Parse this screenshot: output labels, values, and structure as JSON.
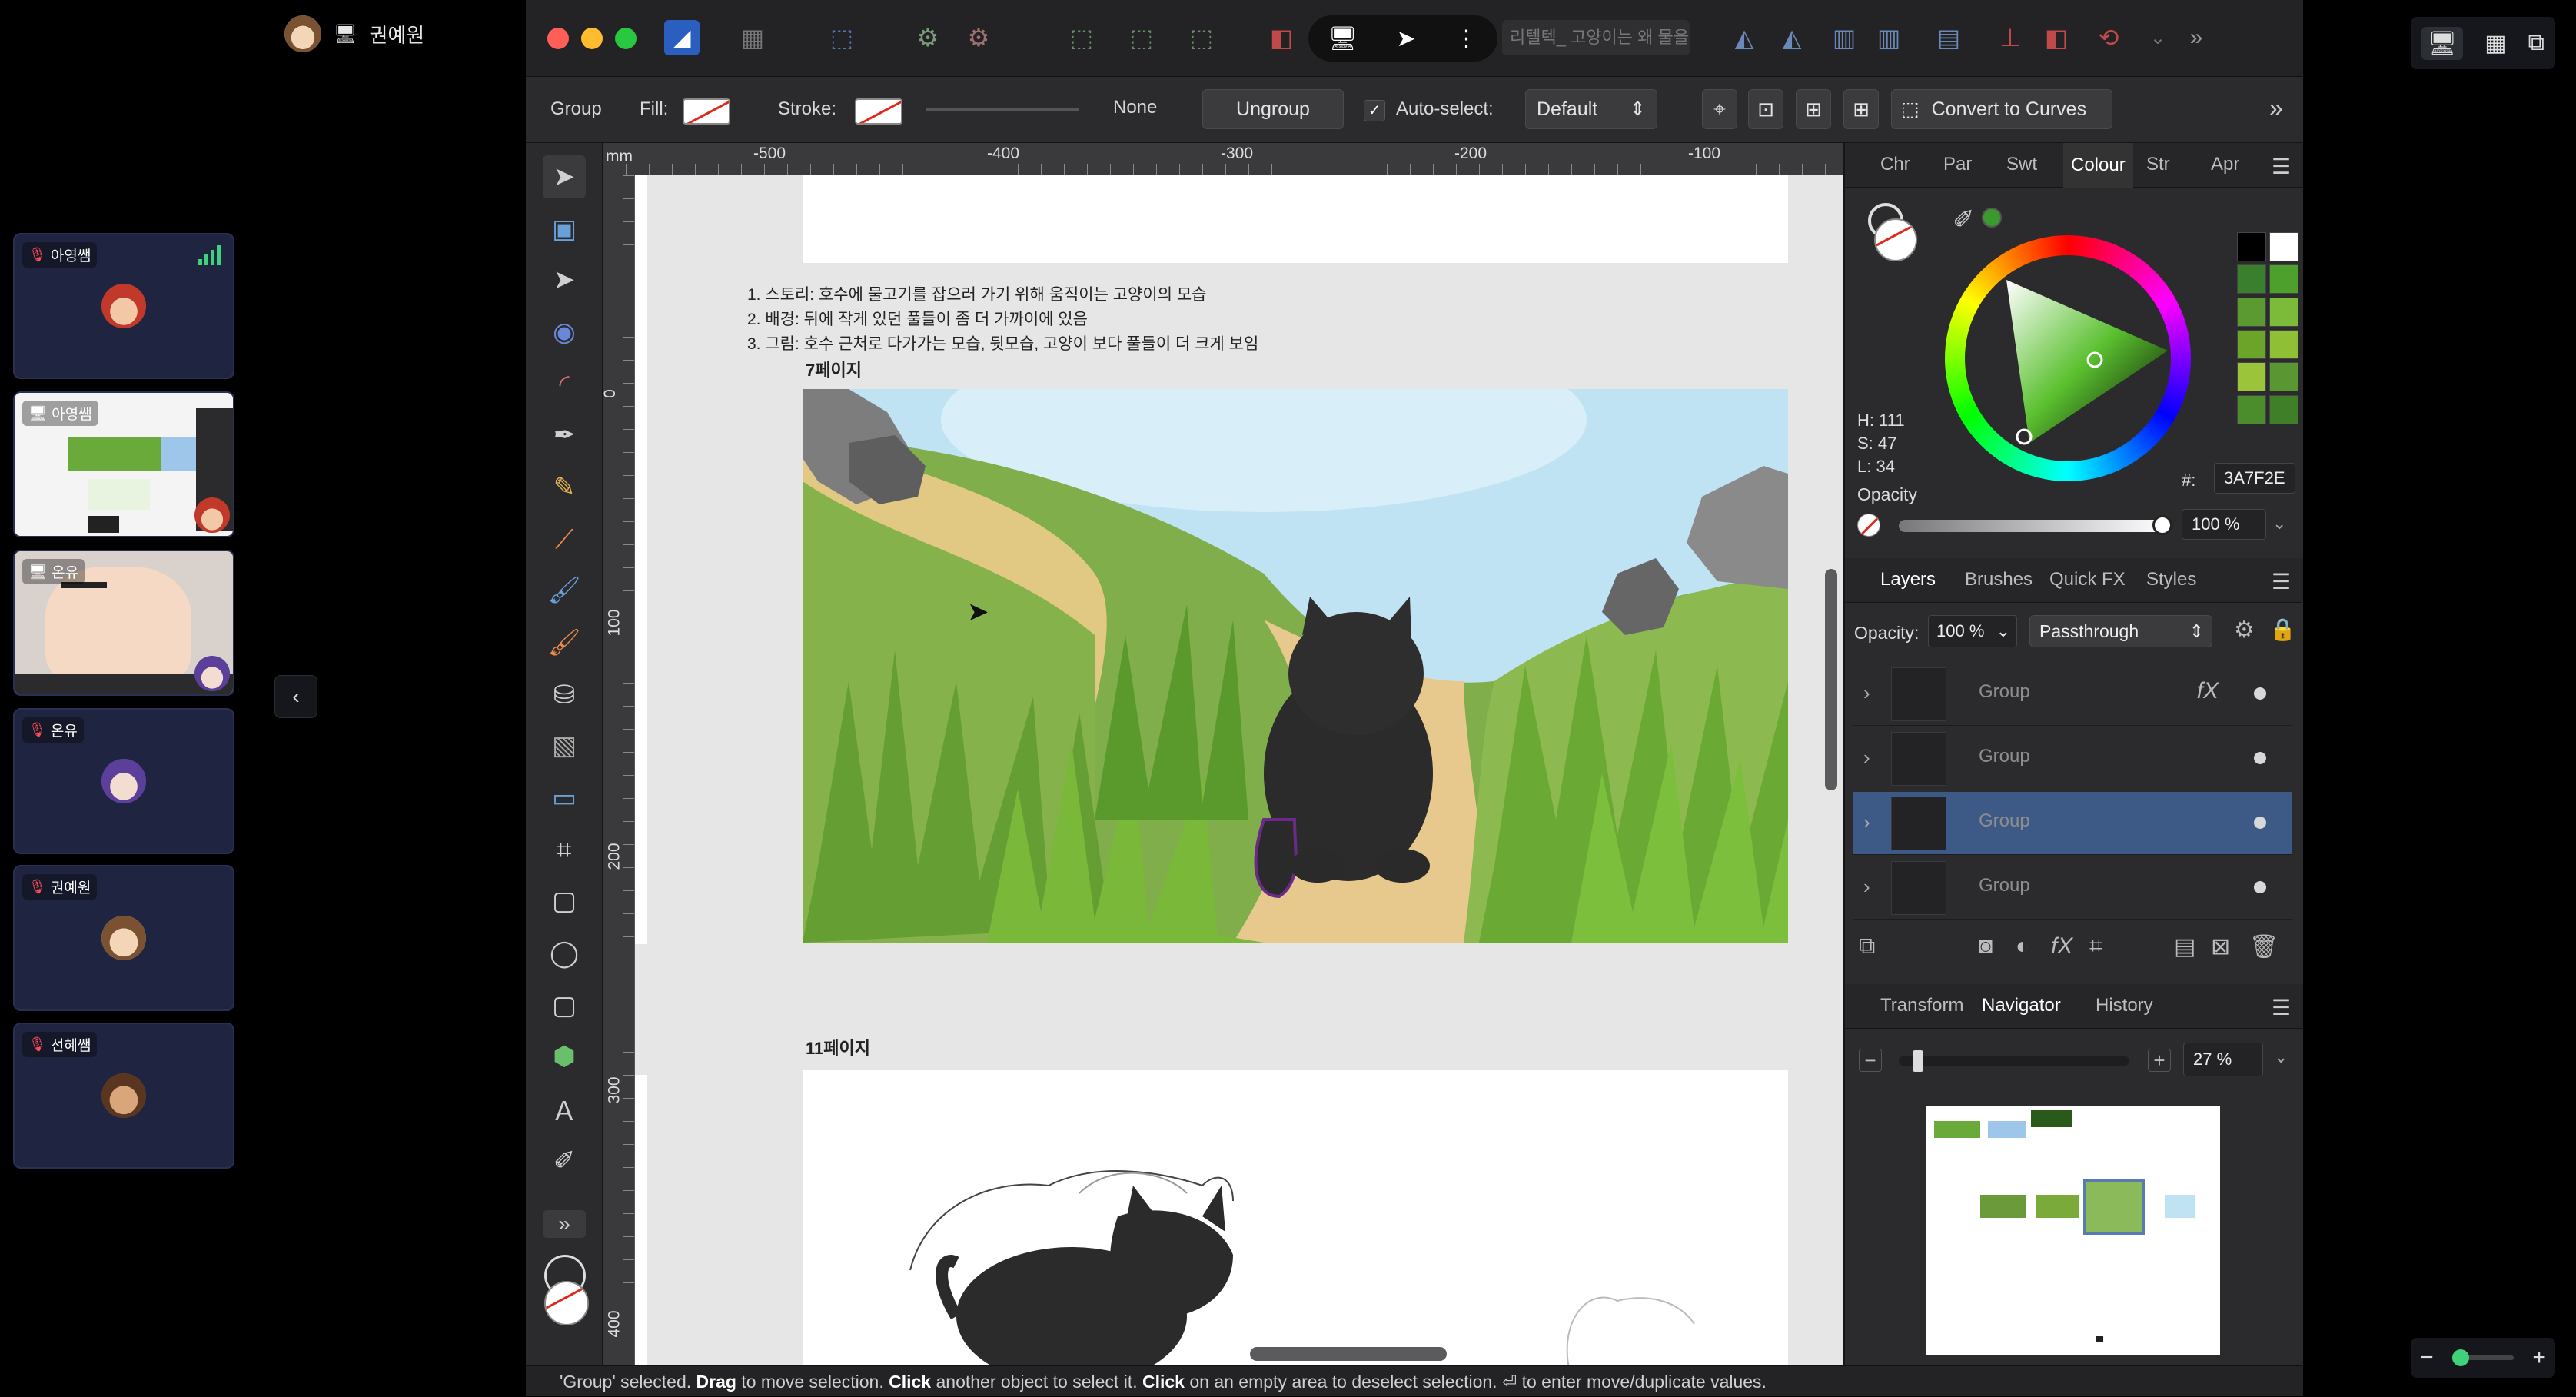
{
  "meeting": {
    "self_name": "권예원",
    "participants": [
      {
        "name": "아영쌤",
        "type": "mic-off"
      },
      {
        "name": "아영쌤",
        "type": "screen-share"
      },
      {
        "name": "온유",
        "type": "screen-share"
      },
      {
        "name": "온유",
        "type": "mic-off"
      },
      {
        "name": "권예원",
        "type": "mic-off"
      },
      {
        "name": "선혜쌤",
        "type": "mic-off"
      }
    ]
  },
  "titlebar": {
    "doc_title": "리텔텍_ 고양이는 왜 물을 ★"
  },
  "context": {
    "selection_type": "Group",
    "fill_label": "Fill:",
    "stroke_label": "Stroke:",
    "stroke_width": "None",
    "ungroup": "Ungroup",
    "autoselect_label": "Auto-select:",
    "autoselect_value": "Default",
    "convert_curves": "Convert to Curves"
  },
  "rulers": {
    "unit": "mm",
    "top_labels": [
      "-500",
      "-400",
      "-300",
      "-200",
      "-100"
    ],
    "left_labels": [
      "0",
      "100",
      "200",
      "300",
      "400"
    ]
  },
  "document": {
    "story_lines": [
      "1. 스토리: 호수에 물고기를 잡으러 가기 위해 움직이는 고양이의 모습",
      "2. 배경: 뒤에 작게 있던 풀들이 좀 더 가까이에 있음",
      "3. 그림: 호수 근처로 다가가는 모습, 뒷모습, 고양이 보다 풀들이 더 크게 보임"
    ],
    "page7_label": "7페이지",
    "page11_label": "11페이지"
  },
  "status": {
    "text_1": "'Group' selected. ",
    "drag": "Drag",
    "text_2": " to move selection. ",
    "click1": "Click",
    "text_3": " another object to select it. ",
    "click2": "Click",
    "text_4": " on an empty area to deselect selection. ⏎ to enter move/duplicate values."
  },
  "colour_panel": {
    "tabs": [
      "Chr",
      "Par",
      "Swt",
      "Colour",
      "Str",
      "Apr"
    ],
    "active_tab": "Colour",
    "h": "H: 111",
    "s": "S: 47",
    "l": "L: 34",
    "hex_label": "#:",
    "hex": "3A7F2E",
    "opacity_label": "Opacity",
    "opacity": "100 %",
    "swatch_colors": [
      "#000000",
      "#ffffff",
      "#3a7f2e",
      "#4ea02d",
      "#5a9a30",
      "#7cbb3a",
      "#6aa52a",
      "#8fbf35",
      "#9bc43a",
      "#5a9632",
      "#4b8d2c",
      "#3f7f28"
    ]
  },
  "layers_panel": {
    "tabs": [
      "Layers",
      "Brushes",
      "Quick FX",
      "Styles"
    ],
    "active_tab": "Layers",
    "opacity_label": "Opacity:",
    "opacity": "100 %",
    "blend": "Passthrough",
    "layers": [
      {
        "name": "Group",
        "fx": true,
        "selected": false
      },
      {
        "name": "Group",
        "fx": false,
        "selected": false
      },
      {
        "name": "Group",
        "fx": false,
        "selected": true
      },
      {
        "name": "Group",
        "fx": false,
        "selected": false
      }
    ]
  },
  "navigator_panel": {
    "tabs": [
      "Transform",
      "Navigator",
      "History"
    ],
    "active_tab": "Navigator",
    "zoom": "27 %"
  },
  "colors": {
    "accent_selected": "#3d5a86",
    "picked_color": "#3A7F2E"
  }
}
